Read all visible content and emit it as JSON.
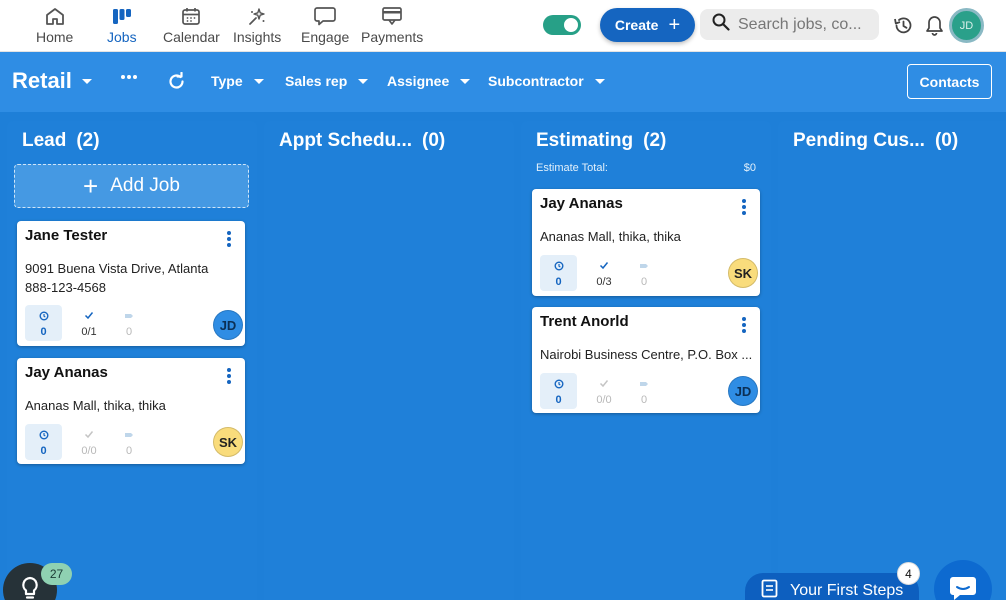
{
  "nav": {
    "items": [
      {
        "label": "Home",
        "icon": "home-icon",
        "active": false
      },
      {
        "label": "Jobs",
        "icon": "jobs-board-icon",
        "active": true
      },
      {
        "label": "Calendar",
        "icon": "calendar-icon",
        "active": false
      },
      {
        "label": "Insights",
        "icon": "sparkle-icon",
        "active": false
      },
      {
        "label": "Engage",
        "icon": "chat-bubble-icon",
        "active": false
      },
      {
        "label": "Payments",
        "icon": "payments-icon",
        "active": false
      }
    ]
  },
  "header": {
    "create_label": "Create",
    "search_placeholder": "Search jobs, co...",
    "user_initials": "JD"
  },
  "toolbar": {
    "board_name": "Retail",
    "filters": [
      "Type",
      "Sales rep",
      "Assignee",
      "Subcontractor"
    ],
    "contacts_label": "Contacts"
  },
  "columns": [
    {
      "title": "Lead",
      "count": "(2)",
      "add_job_label": "Add Job",
      "cards": [
        {
          "name": "Jane Tester",
          "address": "9091 Buena Vista Drive, Atlanta",
          "phone": "888-123-4568",
          "tasks": "0",
          "checks": "0/1",
          "notes": "0",
          "assignee": "JD"
        },
        {
          "name": "Jay Ananas",
          "address": "Ananas Mall, thika, thika",
          "tasks": "0",
          "checks": "0/0",
          "notes": "0",
          "assignee": "SK"
        }
      ]
    },
    {
      "title": "Appt Schedu...",
      "count": "(0)",
      "cards": []
    },
    {
      "title": "Estimating",
      "count": "(2)",
      "estimate_total_label": "Estimate Total:",
      "estimate_total_value": "$0",
      "cards": [
        {
          "name": "Jay Ananas",
          "address": "Ananas Mall, thika, thika",
          "tasks": "0",
          "checks": "0/3",
          "notes": "0",
          "assignee": "SK"
        },
        {
          "name": "Trent Anorld",
          "address": "Nairobi Business Centre, P.O. Box ...",
          "tasks": "0",
          "checks": "0/0",
          "notes": "0",
          "assignee": "JD"
        }
      ]
    },
    {
      "title": "Pending Cus...",
      "count": "(0)",
      "cards": []
    }
  ],
  "footer": {
    "help_count": "27",
    "first_steps_label": "Your First Steps",
    "first_steps_badge": "4"
  },
  "colors": {
    "brand_blue": "#1565c0",
    "board_blue": "#1e7fd8",
    "toggle_green": "#27a087",
    "avatar_jd": "#2f8de4",
    "avatar_sk": "#f9dc7c"
  }
}
